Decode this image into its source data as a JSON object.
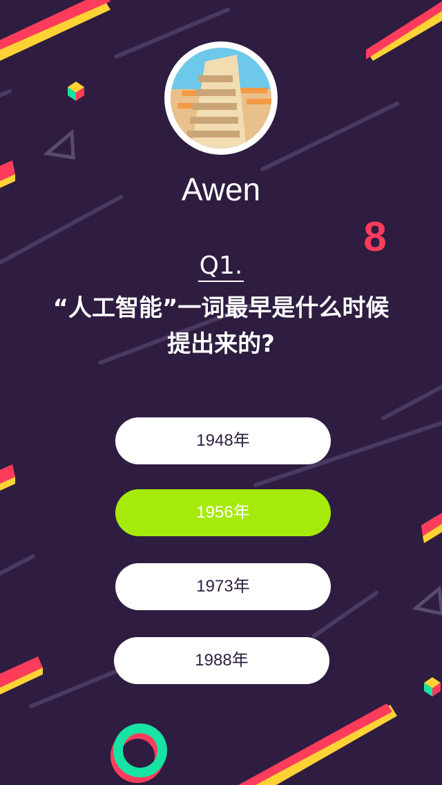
{
  "user": {
    "name": "Awen"
  },
  "timer": {
    "value": "8"
  },
  "question": {
    "number": "Q1.",
    "text": "“人工智能”一词最早是什么时候提出来的?"
  },
  "options": [
    {
      "label": "1948年",
      "selected": false
    },
    {
      "label": "1956年",
      "selected": true
    },
    {
      "label": "1973年",
      "selected": false
    },
    {
      "label": "1988年",
      "selected": false
    }
  ],
  "colors": {
    "background": "#2e1d40",
    "accent_red": "#ff3c5c",
    "accent_yellow": "#ffd335",
    "selected_green": "#a6ea0b",
    "ring_teal": "#17e3a4"
  }
}
